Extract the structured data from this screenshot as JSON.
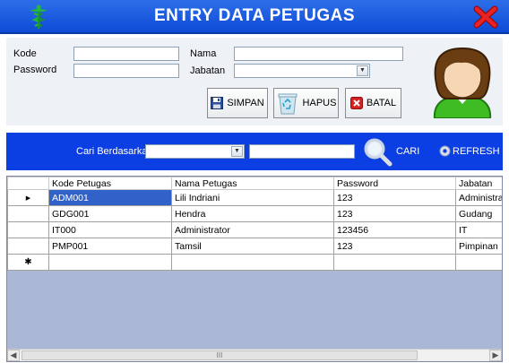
{
  "window": {
    "title": "ENTRY DATA PETUGAS",
    "colors": {
      "title_bar": "#1c5de3",
      "search_bar": "#0c3fe3",
      "selected_cell": "#3162c9",
      "grid_bg": "#abb8d5"
    }
  },
  "form": {
    "kode_label": "Kode",
    "kode_value": "",
    "password_label": "Password",
    "password_value": "",
    "nama_label": "Nama",
    "nama_value": "",
    "jabatan_label": "Jabatan",
    "jabatan_value": ""
  },
  "buttons": {
    "simpan": "SIMPAN",
    "hapus": "HAPUS",
    "batal": "BATAL"
  },
  "search": {
    "label": "Cari Berdasarkan",
    "field_value": "",
    "query_value": "",
    "cari": "CARI",
    "refresh": "REFRESH"
  },
  "grid": {
    "columns": [
      "Kode Petugas",
      "Nama Petugas",
      "Password",
      "Jabatan"
    ],
    "rows": [
      [
        "ADM001",
        "Lili Indriani",
        "123",
        "Administrasi"
      ],
      [
        "GDG001",
        "Hendra",
        "123",
        "Gudang"
      ],
      [
        "IT000",
        "Administrator",
        "123456",
        "IT"
      ],
      [
        "PMP001",
        "Tamsil",
        "123",
        "Pimpinan"
      ]
    ],
    "current_row_marker": "▶",
    "new_row_marker": "✱",
    "scroll_thumb_grip": "III"
  },
  "icons": {
    "logo": "caduceus-icon",
    "close": "close-x-icon",
    "avatar": "user-avatar-icon",
    "save": "floppy-disk-icon",
    "delete": "recycle-bin-icon",
    "cancel": "red-x-icon",
    "search": "magnifier-icon",
    "refresh": "refresh-gear-icon"
  }
}
